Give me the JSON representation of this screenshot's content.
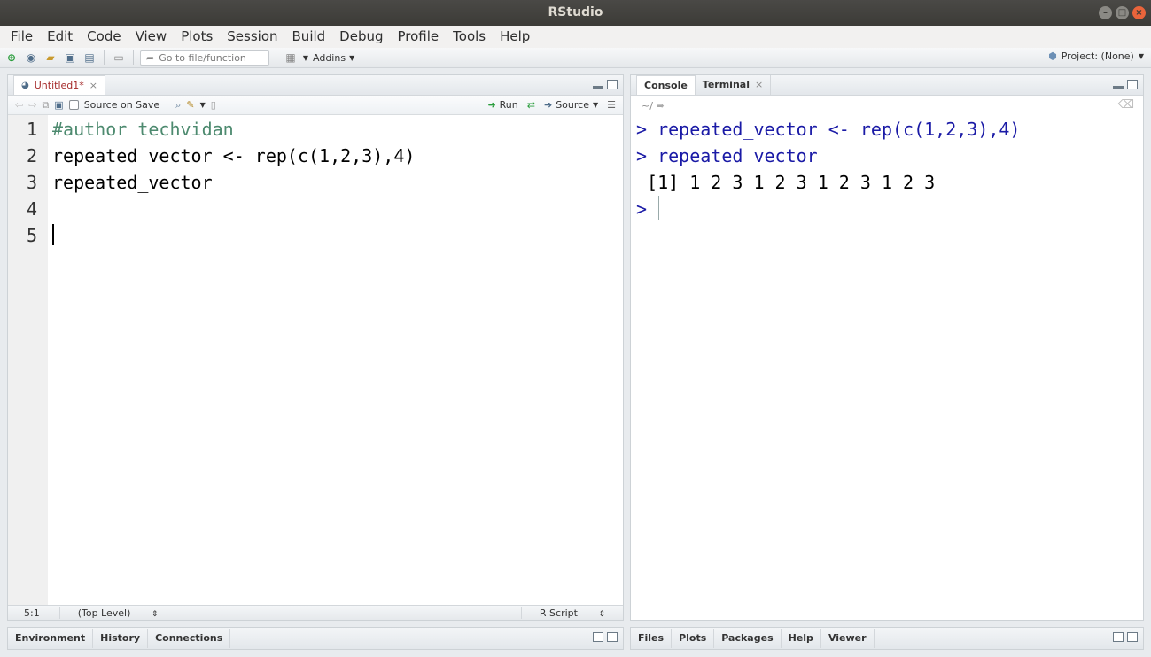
{
  "window": {
    "title": "RStudio"
  },
  "menu": [
    "File",
    "Edit",
    "Code",
    "View",
    "Plots",
    "Session",
    "Build",
    "Debug",
    "Profile",
    "Tools",
    "Help"
  ],
  "toolbar": {
    "goto_placeholder": "Go to file/function",
    "addins_label": "Addins",
    "project_label": "Project: (None)"
  },
  "editor": {
    "tab_label": "Untitled1*",
    "source_on_save_label": "Source on Save",
    "run_label": "Run",
    "source_label": "Source",
    "line_numbers": [
      "1",
      "2",
      "3",
      "4",
      "5"
    ],
    "lines": [
      "#author techvidan",
      "repeated_vector <- rep(c(1,2,3),4)",
      "repeated_vector",
      "",
      ""
    ],
    "cursor_pos": "5:1",
    "scope": "(Top Level)",
    "file_type": "R Script"
  },
  "console": {
    "tabs": [
      "Console",
      "Terminal"
    ],
    "path": "~/",
    "lines": [
      {
        "kind": "input",
        "text": "> repeated_vector <- rep(c(1,2,3),4)"
      },
      {
        "kind": "input",
        "text": "> repeated_vector"
      },
      {
        "kind": "output",
        "text": " [1] 1 2 3 1 2 3 1 2 3 1 2 3"
      },
      {
        "kind": "input",
        "text": ">"
      }
    ]
  },
  "bottom_left_tabs": [
    "Environment",
    "History",
    "Connections"
  ],
  "bottom_right_tabs": [
    "Files",
    "Plots",
    "Packages",
    "Help",
    "Viewer"
  ]
}
